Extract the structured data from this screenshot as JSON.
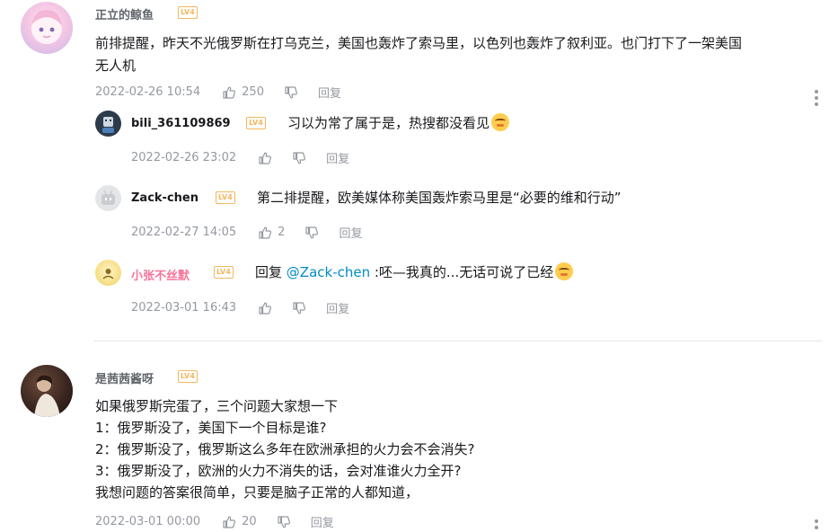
{
  "comments": [
    {
      "user": "正立的鲸鱼",
      "level": "LV4",
      "text_lines": [
        "前排提醒，昨天不光俄罗斯在打乌克兰，美国也轰炸了索马里，以色列也轰炸了叙利亚。也门打下了一架美国",
        "无人机"
      ],
      "time": "2022-02-26 10:54",
      "likes": "250",
      "reply_label": "回复",
      "replies": [
        {
          "user": "bili_361109869",
          "level": "LV4",
          "text": "习以为常了属于是，热搜都没看见",
          "time": "2022-02-26 23:02",
          "likes": "",
          "reply_label": "回复"
        },
        {
          "user": "Zack-chen",
          "level": "LV4",
          "text": "第二排提醒，欧美媒体称美国轰炸索马里是“必要的维和行动”",
          "time": "2022-02-27 14:05",
          "likes": "2",
          "reply_label": "回复"
        },
        {
          "user": "小张不丝默",
          "level": "LV4",
          "text_prefix": "回复",
          "mention": "@Zack-chen",
          "text": " :呸—我真的...无话可说了已经",
          "time": "2022-03-01 16:43",
          "likes": "",
          "reply_label": "回复"
        }
      ]
    },
    {
      "user": "是茜茜酱呀",
      "level": "LV4",
      "text_lines": [
        "如果俄罗斯完蛋了，三个问题大家想一下",
        "1：俄罗斯没了，美国下一个目标是谁?",
        "2：俄罗斯没了，俄罗斯这么多年在欧洲承担的火力会不会消失?",
        "3：俄罗斯没了，欧洲的火力不消失的话，会对准谁火力全开?",
        "我想问题的答案很简单，只要是脑子正常的人都知道，"
      ],
      "time": "2022-03-01 00:00",
      "likes": "20",
      "reply_label": "回复"
    }
  ],
  "icons": {
    "like": "thumbs-up-icon",
    "dislike": "thumbs-down-icon",
    "more": "more-vertical-icon",
    "emoji": "facepalm-emoji"
  },
  "colors": {
    "username": "#61666d",
    "username_vip": "#fb7299",
    "level_badge": "#f3b860",
    "meta": "#9499a0",
    "mention": "#008ac5",
    "divider": "#e3e5e7"
  }
}
